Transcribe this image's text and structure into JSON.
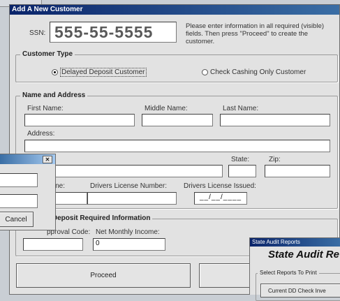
{
  "customer_form": {
    "title": "Add A New Customer",
    "ssn_label": "SSN:",
    "ssn_value": "555-55-5555",
    "instructions": "Please enter information in all required (visible) fields. Then press \"Proceed\" to create the customer.",
    "customer_type": {
      "legend": "Customer Type",
      "option_delayed": "Delayed Deposit Customer",
      "option_check_cashing": "Check Cashing Only Customer",
      "selected": "Delayed Deposit Customer"
    },
    "name_address": {
      "legend": "Name and Address",
      "first_name_label": "First Name:",
      "first_name_value": "",
      "middle_name_label": "Middle Name:",
      "middle_name_value": "",
      "last_name_label": "Last Name:",
      "last_name_value": "",
      "address_label": "Address:",
      "address_value": "",
      "state_label": "State:",
      "state_value": "",
      "zip_label": "Zip:",
      "zip_value": "",
      "phone_label_partial": "hone:",
      "phone_value": "",
      "license_number_label": "Drivers License Number:",
      "license_number_value": "",
      "license_issued_label": "Drivers License Issued:",
      "license_issued_value": "__/__/____"
    },
    "deposit_info": {
      "legend_partial": "d Deposit Required Information",
      "approval_code_label_partial": "pproval Code:",
      "approval_code_value": "",
      "net_income_label": "Net Monthly Income:",
      "net_income_value": "0"
    },
    "proceed_label": "Proceed"
  },
  "small_dialog": {
    "close_glyph": "✕",
    "cancel_label": "Cancel"
  },
  "state_audit": {
    "window_title": "State Audit Reports",
    "heading_partial": "State Audit Re",
    "select_legend": "Select Reports To Print",
    "report_button_partial": "Current DD Check Inve"
  },
  "colors": {
    "titlebar": "#0a246a",
    "dialog_bg": "#e2e2e2",
    "ssn_text": "#5a5a5a"
  }
}
